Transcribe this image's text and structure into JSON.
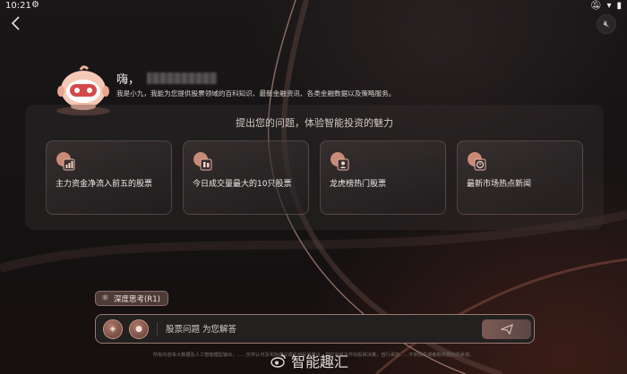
{
  "status_bar": {
    "time": "10:21",
    "icons": [
      "gear-icon",
      "notifications-off-icon",
      "wifi-icon",
      "battery-icon"
    ]
  },
  "header": {
    "back_icon": "back-chevron-icon",
    "sound_icon": "speaker-muted-icon"
  },
  "greeting": {
    "hello": "嗨，",
    "intro": "我是小九，我能为您提供股票领域的百科知识、最新金融资讯、各类金融数据以及策略服务。"
  },
  "suggestions": {
    "title": "提出您的问题，体验智能投资的魅力",
    "items": [
      {
        "label": "主力资金净流入前五的股票",
        "icon": "bar-chart-icon"
      },
      {
        "label": "今日成交量最大的10只股票",
        "icon": "candlestick-icon"
      },
      {
        "label": "龙虎榜热门股票",
        "icon": "user-rank-icon"
      },
      {
        "label": "最新市场热点新闻",
        "icon": "news-icon"
      }
    ]
  },
  "input_bar": {
    "deep_think_label": "深度思考(R1)",
    "placeholder": "股票问题 为您解答",
    "tool_icons": [
      "stock-tool-icon",
      "microphone-icon"
    ],
    "send_icon": "send-icon"
  },
  "footer": {
    "disclaimer": "所有内容本大数据及人工智能模型输出，……仅供认可及实际建议或任何投资建议，您应当自主作出投资决策，自行承担……不受损失或者取得盈利的承诺。",
    "watermark": "智能趣汇"
  },
  "colors": {
    "accent": "#c99384",
    "background": "#161314",
    "card_border": "#a0827d"
  }
}
